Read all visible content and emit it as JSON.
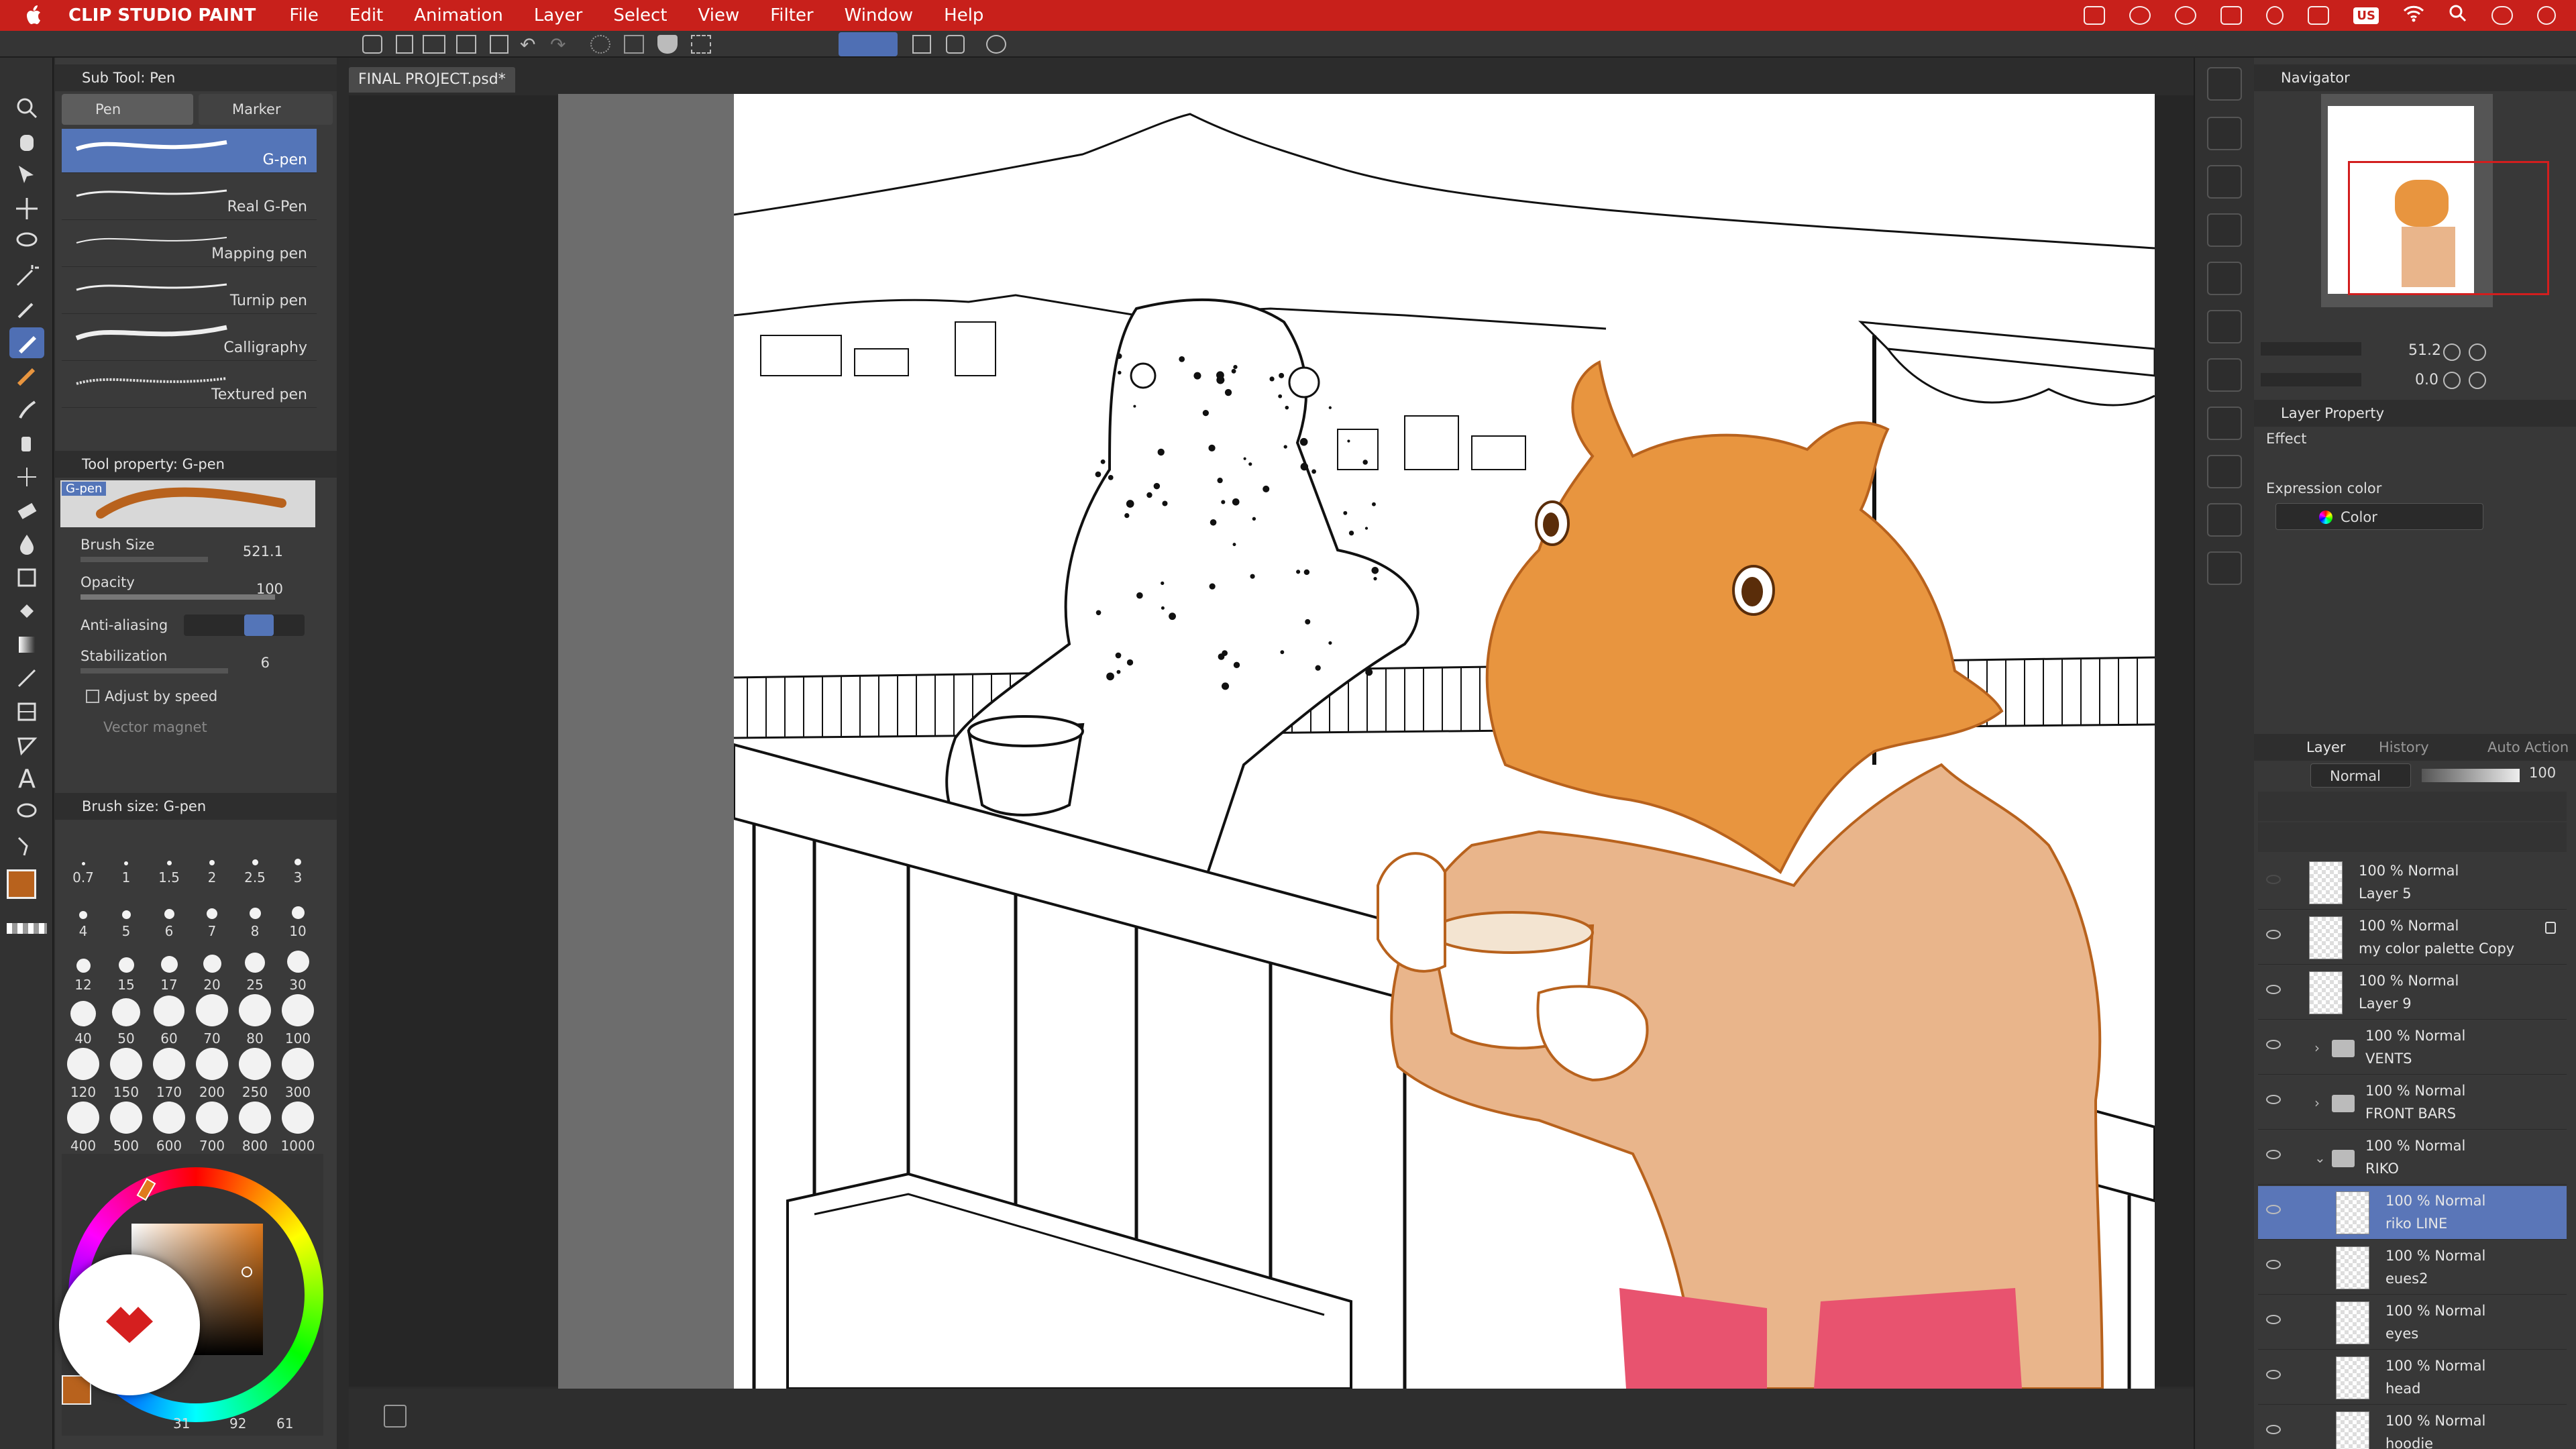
{
  "menubar": {
    "app_name": "CLIP STUDIO PAINT",
    "items": [
      "File",
      "Edit",
      "Animation",
      "Layer",
      "Select",
      "View",
      "Filter",
      "Window",
      "Help"
    ],
    "status_icons": [
      "window-icon",
      "creative-cloud-icon",
      "circle-icon",
      "display-icon",
      "record-icon",
      "control-center-icon",
      "input-source-icon",
      "wifi-icon",
      "search-icon",
      "toggle-icon",
      "clock-icon"
    ],
    "input_source": "US"
  },
  "document": {
    "tab_title": "FINAL PROJECT.psd*"
  },
  "subtool_panel": {
    "title": "Sub Tool: Pen",
    "tabs": [
      {
        "label": "Pen"
      },
      {
        "label": "Marker"
      }
    ],
    "brushes": [
      "G-pen",
      "Real G-Pen",
      "Mapping pen",
      "Turnip pen",
      "Calligraphy",
      "Textured pen"
    ],
    "selected_brush": "G-pen"
  },
  "tool_property": {
    "title": "Tool property: G-pen",
    "preview_label": "G-pen",
    "brush_size_label": "Brush Size",
    "brush_size_value": "521.1",
    "opacity_label": "Opacity",
    "opacity_value": "100",
    "antialiasing_label": "Anti-aliasing",
    "stabilization_label": "Stabilization",
    "stabilization_value": "6",
    "adjust_by_speed_label": "Adjust by speed",
    "vector_magnet_label": "Vector magnet"
  },
  "brush_size_panel": {
    "title": "Brush size: G-pen",
    "sizes": [
      "0.7",
      "1",
      "1.5",
      "2",
      "2.5",
      "3",
      "4",
      "5",
      "6",
      "7",
      "8",
      "10",
      "12",
      "15",
      "17",
      "20",
      "25",
      "30",
      "40",
      "50",
      "60",
      "70",
      "80",
      "100",
      "120",
      "150",
      "170",
      "200",
      "250",
      "300",
      "400",
      "500",
      "600",
      "700",
      "800",
      "1000"
    ]
  },
  "color": {
    "main_color": "#b8621d",
    "sub_color": "#ffffff",
    "hue_ring_accent": "#e07b1e",
    "picker_values": [
      "31",
      "92",
      "61"
    ]
  },
  "navigator": {
    "title": "Navigator",
    "zoom": "51.2",
    "rotation": "0.0"
  },
  "layer_property": {
    "title": "Layer Property",
    "effect_label": "Effect",
    "expression_color_label": "Expression color",
    "expression_color_value": "Color"
  },
  "layers_panel": {
    "tabs": [
      {
        "label": "Layer"
      },
      {
        "label": "History"
      },
      {
        "label": "Auto Action"
      }
    ],
    "blend_mode": "Normal",
    "opacity": "100",
    "layers": [
      {
        "meta": "100 % Normal",
        "name": "Layer 5",
        "kind": "layer",
        "visible": false
      },
      {
        "meta": "100 % Normal",
        "name": "my color palette Copy",
        "kind": "layer",
        "visible": true,
        "locked": true
      },
      {
        "meta": "100 % Normal",
        "name": "Layer 9",
        "kind": "layer",
        "visible": true
      },
      {
        "meta": "100 % Normal",
        "name": "VENTS",
        "kind": "folder",
        "visible": true
      },
      {
        "meta": "100 % Normal",
        "name": "FRONT BARS",
        "kind": "folder",
        "visible": true
      },
      {
        "meta": "100 % Normal",
        "name": "RIKO",
        "kind": "folder-open",
        "visible": true
      },
      {
        "meta": "100 % Normal",
        "name": "riko LINE",
        "kind": "layer",
        "visible": true,
        "selected": true,
        "indent": true
      },
      {
        "meta": "100 % Normal",
        "name": "eues2",
        "kind": "layer",
        "visible": true,
        "indent": true
      },
      {
        "meta": "100 % Normal",
        "name": "eyes",
        "kind": "layer",
        "visible": true,
        "indent": true
      },
      {
        "meta": "100 % Normal",
        "name": "head",
        "kind": "layer",
        "visible": true,
        "indent": true
      },
      {
        "meta": "100 % Normal",
        "name": "hoodie",
        "kind": "layer",
        "visible": true,
        "indent": true
      }
    ]
  },
  "artwork": {
    "description_colors": {
      "orange_head": "#e8953f",
      "hoodie": "#e9b58b",
      "pants": "#e8536f",
      "line": "#1a1a1a"
    }
  }
}
